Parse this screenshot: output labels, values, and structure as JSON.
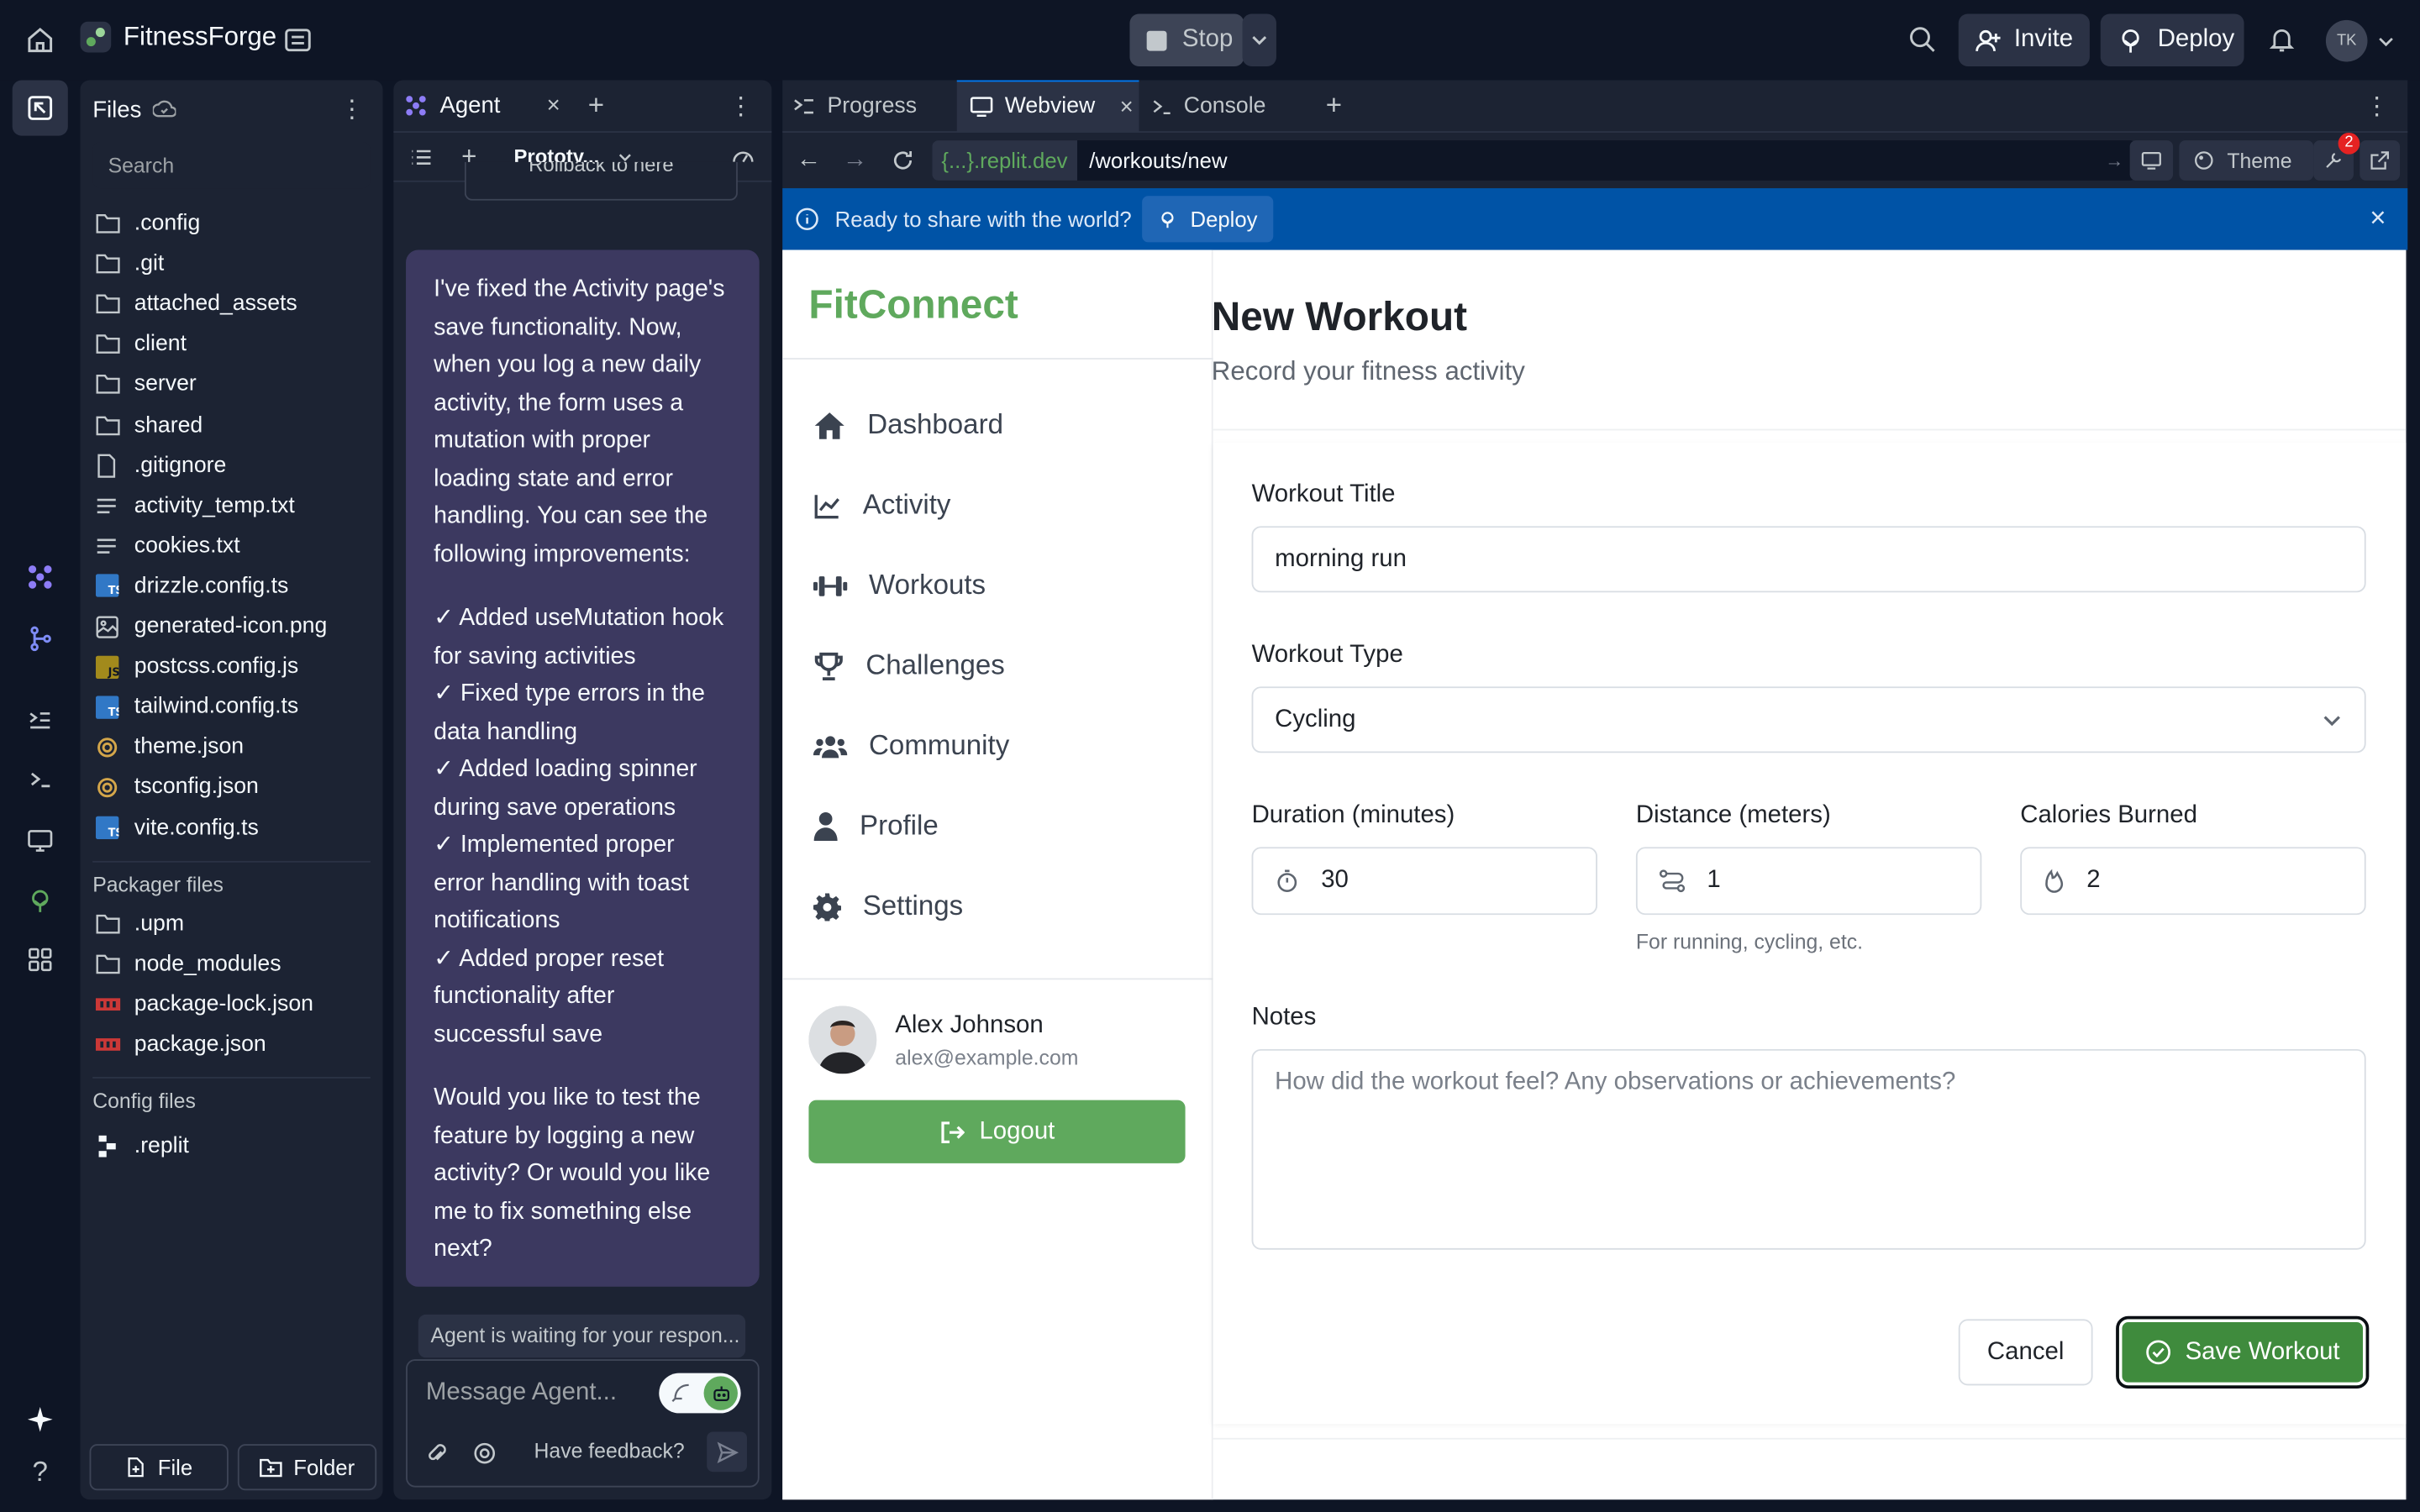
{
  "topbar": {
    "app_name": "FitnessForge",
    "stop_label": "Stop",
    "invite_label": "Invite",
    "deploy_label": "Deploy",
    "avatar_initials": "TK"
  },
  "files": {
    "title": "Files",
    "search_placeholder": "Search",
    "items": [
      ".config",
      ".git",
      "attached_assets",
      "client",
      "server",
      "shared",
      ".gitignore",
      "activity_temp.txt",
      "cookies.txt",
      "drizzle.config.ts",
      "generated-icon.png",
      "postcss.config.js",
      "tailwind.config.ts",
      "theme.json",
      "tsconfig.json",
      "vite.config.ts"
    ],
    "packager_label": "Packager files",
    "packager_items": [
      ".upm",
      "node_modules",
      "package-lock.json",
      "package.json"
    ],
    "config_label": "Config files",
    "config_items": [
      ".replit"
    ],
    "new_file": "File",
    "new_folder": "Folder"
  },
  "agent": {
    "tab_label": "Agent",
    "mode_label": "Prototy...",
    "rollback": "Rollback to here",
    "message": {
      "intro": "I've fixed the Activity page's save functionality. Now, when you log a new daily activity, the form uses a mutation with proper loading state and error handling. You can see the following improvements:",
      "bullets": [
        "✓ Added useMutation hook for saving activities",
        "✓ Fixed type errors in the data handling",
        "✓ Added loading spinner during save operations",
        "✓ Implemented proper error handling with toast notifications",
        "✓ Added proper reset functionality after successful save"
      ],
      "outro": "Would you like to test the feature by logging a new activity? Or would you like me to fix something else next?"
    },
    "waiting": "Agent is waiting for your respon...",
    "input_placeholder": "Message Agent...",
    "feedback": "Have feedback?"
  },
  "preview": {
    "tabs": [
      "Progress",
      "Webview",
      "Console"
    ],
    "url_domain": "{...}.replit.dev",
    "url_path": "/workouts/new",
    "theme_label": "Theme",
    "badge_count": "2",
    "banner": {
      "text": "Ready to share with the world?",
      "deploy": "Deploy"
    }
  },
  "app": {
    "brand": "FitConnect",
    "nav": [
      "Dashboard",
      "Activity",
      "Workouts",
      "Challenges",
      "Community",
      "Profile",
      "Settings"
    ],
    "user": {
      "name": "Alex Johnson",
      "email": "alex@example.com"
    },
    "logout": "Logout",
    "page_title": "New Workout",
    "page_subtitle": "Record your fitness activity",
    "form": {
      "title_label": "Workout Title",
      "title_value": "morning run",
      "type_label": "Workout Type",
      "type_value": "Cycling",
      "duration_label": "Duration (minutes)",
      "duration_value": "30",
      "distance_label": "Distance (meters)",
      "distance_value": "1",
      "distance_hint": "For running, cycling, etc.",
      "calories_label": "Calories Burned",
      "calories_value": "2",
      "notes_label": "Notes",
      "notes_placeholder": "How did the workout feel? Any observations or achievements?",
      "cancel": "Cancel",
      "save": "Save Workout"
    }
  },
  "colors": {
    "accent_green": "#5fa95d",
    "banner_blue": "#0053a6",
    "agent_bubble": "#3c3960"
  }
}
